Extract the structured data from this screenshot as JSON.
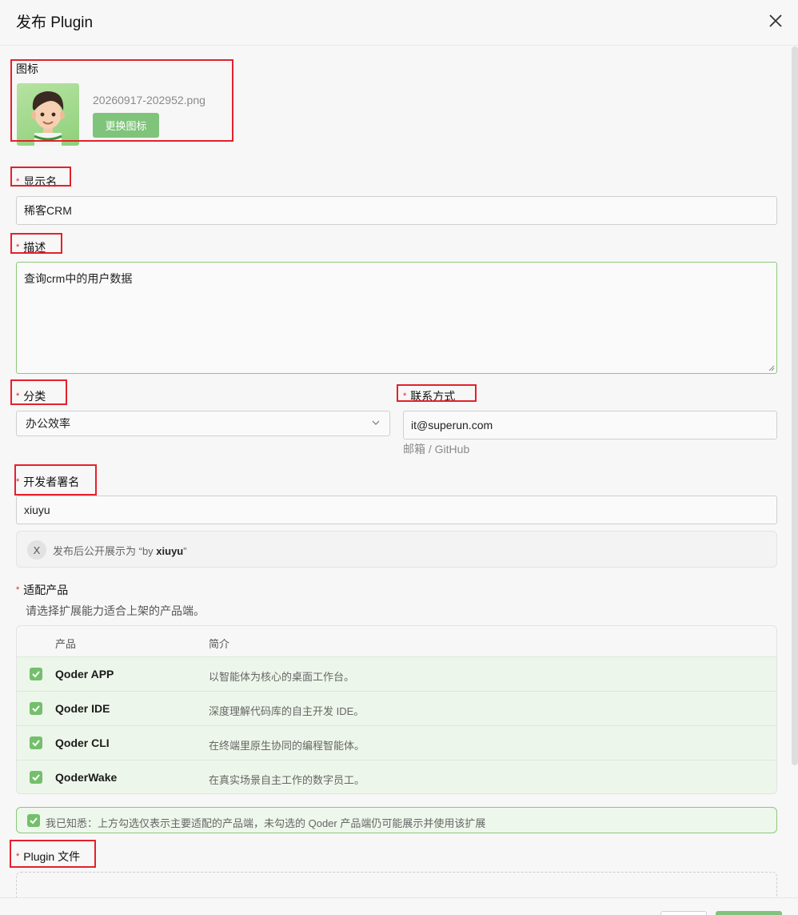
{
  "dialog": {
    "title": "发布 Plugin"
  },
  "icon_section": {
    "label": "图标",
    "filename": "20260917-202952.png",
    "change_button": "更换图标"
  },
  "display_name": {
    "label": "显示名",
    "required_mark": "*",
    "value": "稀客CRM"
  },
  "description": {
    "label": "描述",
    "required_mark": "*",
    "value": "查询crm中的用户数据"
  },
  "category": {
    "label": "分类",
    "required_mark": "*",
    "selected": "办公效率"
  },
  "contact": {
    "label": "联系方式",
    "required_mark": "*",
    "value": "it@superun.com",
    "hint": "邮箱 / GitHub"
  },
  "developer": {
    "label": "开发者署名",
    "required_mark": "*",
    "value": "xiuyu",
    "preview_avatar": "X",
    "preview_prefix": "发布后公开展示为 “by ",
    "preview_name": "xiuyu",
    "preview_suffix": "”"
  },
  "products": {
    "label": "适配产品",
    "required_mark": "*",
    "hint": "请选择扩展能力适合上架的产品端。",
    "col_product": "产品",
    "col_intro": "简介",
    "rows": [
      {
        "name": "Qoder APP",
        "desc": "以智能体为核心的桌面工作台。",
        "checked": true
      },
      {
        "name": "Qoder IDE",
        "desc": "深度理解代码库的自主开发 IDE。",
        "checked": true
      },
      {
        "name": "Qoder CLI",
        "desc": "在终端里原生协同的编程智能体。",
        "checked": true
      },
      {
        "name": "QoderWake",
        "desc": "在真实场景自主工作的数字员工。",
        "checked": true
      }
    ]
  },
  "acknowledge": {
    "text": "我已知悉：上方勾选仅表示主要适配的产品端，未勾选的 Qoder 产品端仍可能展示并使用该扩展",
    "checked": true
  },
  "plugin_file": {
    "label": "Plugin 文件",
    "required_mark": "*"
  },
  "colors": {
    "accent_green": "#7fc47a",
    "annotation_red": "#e5202b"
  }
}
